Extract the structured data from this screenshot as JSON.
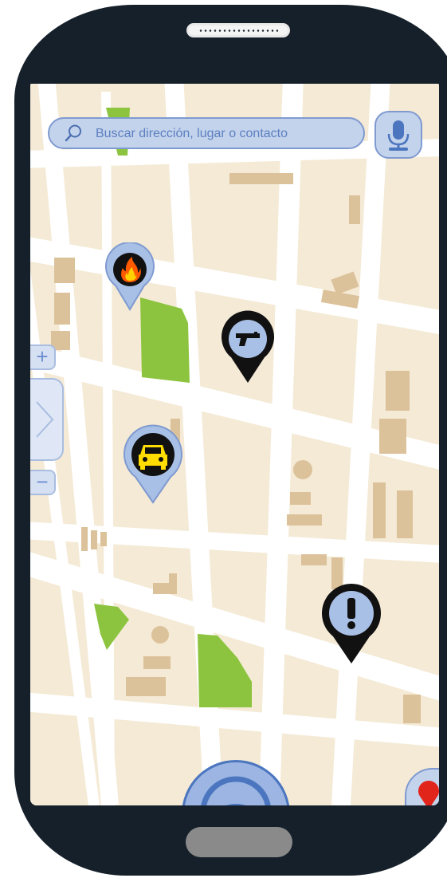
{
  "search": {
    "placeholder": "Buscar dirección, lugar o contacto",
    "icon": "search-icon"
  },
  "controls": {
    "mic_icon": "microphone-icon",
    "zoom_in_label": "+",
    "zoom_out_label": "−",
    "expand_icon": "chevron-right-icon",
    "nav_icon": "navigation-icon",
    "location_icon": "location-pin-icon"
  },
  "markers": [
    {
      "type": "fire",
      "icon": "fire-icon"
    },
    {
      "type": "crime",
      "icon": "gun-icon"
    },
    {
      "type": "traffic",
      "icon": "car-icon"
    },
    {
      "type": "alert",
      "icon": "exclamation-icon"
    }
  ],
  "colors": {
    "map_background": "#f4ead5",
    "block": "#f1e6cd",
    "road": "#ffffff",
    "park": "#8cc43f",
    "building": "#dcc29a",
    "ui_accent": "#7f9ad0",
    "ui_fill": "#c4d3ec",
    "marker_dark": "#111111",
    "marker_light": "#a8c0e6",
    "location_pin": "#e1251b",
    "phone_body": "#16202a"
  }
}
